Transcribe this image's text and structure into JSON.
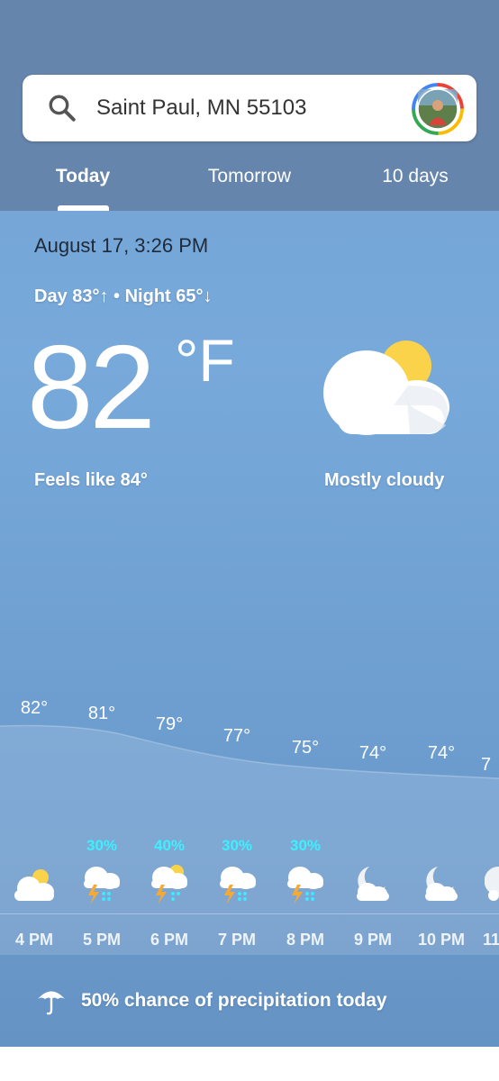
{
  "search": {
    "location": "Saint Paul, MN 55103"
  },
  "tabs": [
    {
      "label": "Today"
    },
    {
      "label": "Tomorrow"
    },
    {
      "label": "10 days"
    }
  ],
  "current": {
    "datetime": "August 17, 3:26 PM",
    "day_night": "Day 83°↑ • Night 65°↓",
    "temperature": "82",
    "unit": "°F",
    "feels_like": "Feels like 84°",
    "condition": "Mostly cloudy",
    "condition_icon": "partly-cloudy-icon"
  },
  "hourly": [
    {
      "time": "4 PM",
      "temp": "82°",
      "precip": "",
      "icon": "partly-cloudy-icon"
    },
    {
      "time": "5 PM",
      "temp": "81°",
      "precip": "30%",
      "icon": "thunderstorm-icon"
    },
    {
      "time": "6 PM",
      "temp": "79°",
      "precip": "40%",
      "icon": "sunny-thunderstorm-icon"
    },
    {
      "time": "7 PM",
      "temp": "77°",
      "precip": "30%",
      "icon": "thunderstorm-icon"
    },
    {
      "time": "8 PM",
      "temp": "75°",
      "precip": "30%",
      "icon": "thunderstorm-icon"
    },
    {
      "time": "9 PM",
      "temp": "74°",
      "precip": "",
      "icon": "cloudy-night-icon"
    },
    {
      "time": "10 PM",
      "temp": "74°",
      "precip": "",
      "icon": "cloudy-night-icon"
    },
    {
      "time": "11",
      "temp": "7",
      "precip": "",
      "icon": "cloudy-night-icon"
    }
  ],
  "precip_summary": "50% chance of precipitation today",
  "colors": {
    "precip_text": "#3ef0ff",
    "header_bg": "#6585ac",
    "sky": "#78a9db"
  }
}
